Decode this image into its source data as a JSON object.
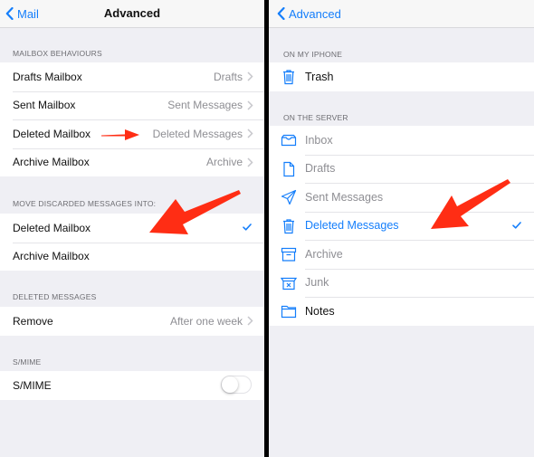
{
  "left": {
    "nav": {
      "back_label": "Mail",
      "title": "Advanced"
    },
    "sections": [
      {
        "header": "MAILBOX BEHAVIOURS",
        "rows": [
          {
            "label": "Drafts Mailbox",
            "value": "Drafts"
          },
          {
            "label": "Sent Mailbox",
            "value": "Sent Messages"
          },
          {
            "label": "Deleted Mailbox",
            "value": "Deleted Messages"
          },
          {
            "label": "Archive Mailbox",
            "value": "Archive"
          }
        ]
      },
      {
        "header": "MOVE DISCARDED MESSAGES INTO:",
        "rows": [
          {
            "label": "Deleted Mailbox",
            "selected": true
          },
          {
            "label": "Archive Mailbox",
            "selected": false
          }
        ]
      },
      {
        "header": "DELETED MESSAGES",
        "rows": [
          {
            "label": "Remove",
            "value": "After one week"
          }
        ]
      },
      {
        "header": "S/MIME",
        "rows": [
          {
            "label": "S/MIME",
            "toggle_on": false
          }
        ]
      }
    ]
  },
  "right": {
    "nav": {
      "back_label": "Advanced"
    },
    "sections": [
      {
        "header": "ON MY IPHONE",
        "rows": [
          {
            "label": "Trash",
            "icon": "trash-icon",
            "state": "enabled"
          }
        ]
      },
      {
        "header": "ON THE SERVER",
        "rows": [
          {
            "label": "Inbox",
            "icon": "inbox-icon",
            "state": "disabled"
          },
          {
            "label": "Drafts",
            "icon": "drafts-icon",
            "state": "disabled"
          },
          {
            "label": "Sent Messages",
            "icon": "sent-icon",
            "state": "disabled"
          },
          {
            "label": "Deleted Messages",
            "icon": "trash-icon",
            "state": "selected"
          },
          {
            "label": "Archive",
            "icon": "archive-icon",
            "state": "disabled"
          },
          {
            "label": "Junk",
            "icon": "junk-icon",
            "state": "disabled"
          },
          {
            "label": "Notes",
            "icon": "folder-icon",
            "state": "enabled"
          }
        ]
      }
    ]
  },
  "colors": {
    "accent": "#147efb",
    "annotation_arrow": "#ff2d14",
    "disabled_text": "#8e8e93",
    "background": "#efeff4"
  }
}
